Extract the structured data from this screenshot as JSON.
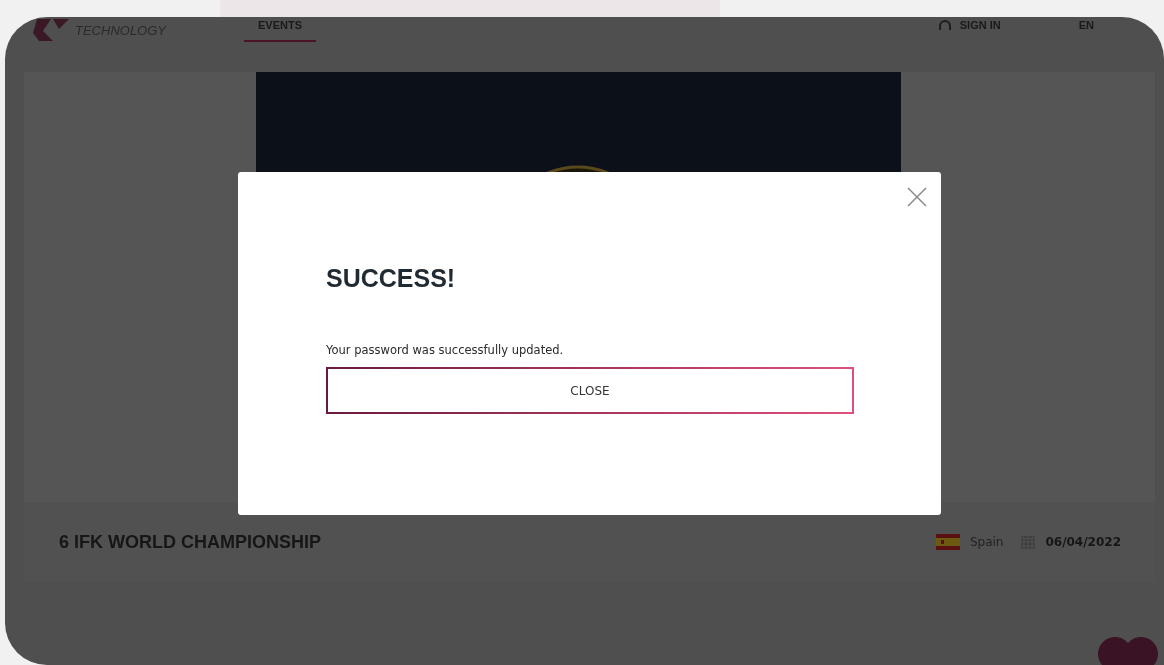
{
  "header": {
    "logo_text": "TECHNOLOGY",
    "nav": [
      {
        "label": "EVENTS",
        "selected": true
      }
    ],
    "sign_in": "SIGN IN",
    "language": "EN"
  },
  "event": {
    "title": "6 IFK WORLD CHAMPIONSHIP",
    "country": "Spain",
    "date": "06/04/2022"
  },
  "dialog": {
    "title": "SUCCESS!",
    "message": "Your password was successfully updated.",
    "button": "CLOSE"
  }
}
